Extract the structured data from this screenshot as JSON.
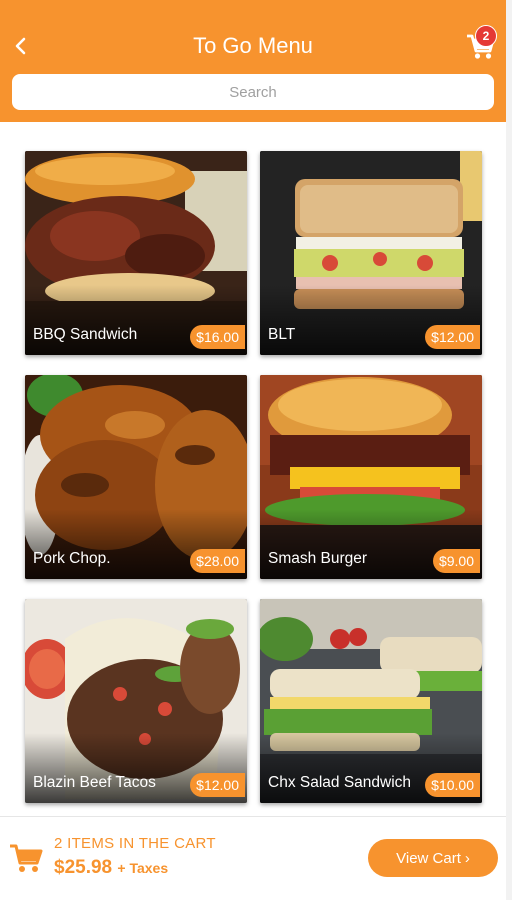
{
  "header": {
    "title": "To Go Menu",
    "cart_badge": "2",
    "search_placeholder": "Search"
  },
  "menu": {
    "items": [
      {
        "name": "BBQ Sandwich",
        "price": "$16.00"
      },
      {
        "name": "BLT",
        "price": "$12.00"
      },
      {
        "name": "Pork Chop.",
        "price": "$28.00"
      },
      {
        "name": "Smash Burger",
        "price": "$9.00"
      },
      {
        "name": "Blazin Beef Tacos",
        "price": "$12.00"
      },
      {
        "name": "Chx Salad Sandwich",
        "price": "$10.00"
      }
    ]
  },
  "footer": {
    "items_text": "2 ITEMS IN THE CART",
    "total": "$25.98",
    "taxes": "+ Taxes",
    "view_cart_label": "View Cart",
    "chevron": "›"
  },
  "colors": {
    "accent": "#F7932E",
    "badge": "#E53935"
  },
  "icons": {
    "back": "chevron-left-icon",
    "cart": "shopping-cart-icon"
  }
}
